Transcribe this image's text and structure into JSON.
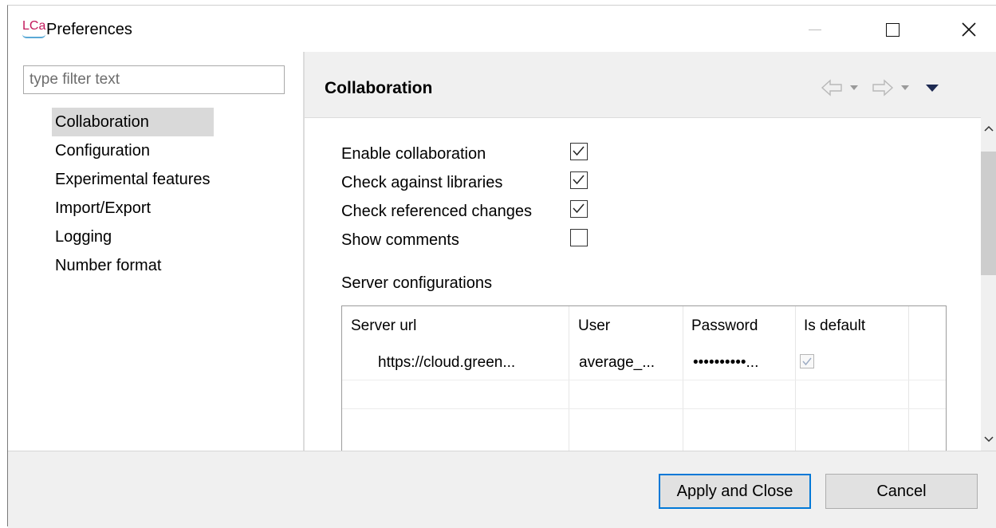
{
  "window": {
    "app_icon_text": "LCa",
    "title": "Preferences"
  },
  "left": {
    "filter_placeholder": "type filter text",
    "items": [
      {
        "label": "Collaboration",
        "selected": true
      },
      {
        "label": "Configuration"
      },
      {
        "label": "Experimental features"
      },
      {
        "label": "Import/Export"
      },
      {
        "label": "Logging"
      },
      {
        "label": "Number format"
      }
    ]
  },
  "page": {
    "title": "Collaboration",
    "options": [
      {
        "label": "Enable collaboration",
        "checked": true
      },
      {
        "label": "Check against libraries",
        "checked": true
      },
      {
        "label": "Check referenced changes",
        "checked": true
      },
      {
        "label": "Show comments",
        "checked": false
      }
    ],
    "section_label": "Server configurations",
    "table": {
      "headers": [
        "Server url",
        "User",
        "Password",
        "Is default"
      ],
      "rows": [
        {
          "url": "https://cloud.green...",
          "user": "average_...",
          "password": "••••••••••...",
          "is_default": true
        }
      ]
    }
  },
  "buttons": {
    "apply": "Apply and Close",
    "cancel": "Cancel"
  },
  "colors": {
    "accent": "#0078d7",
    "selection": "#d9d9d9"
  }
}
